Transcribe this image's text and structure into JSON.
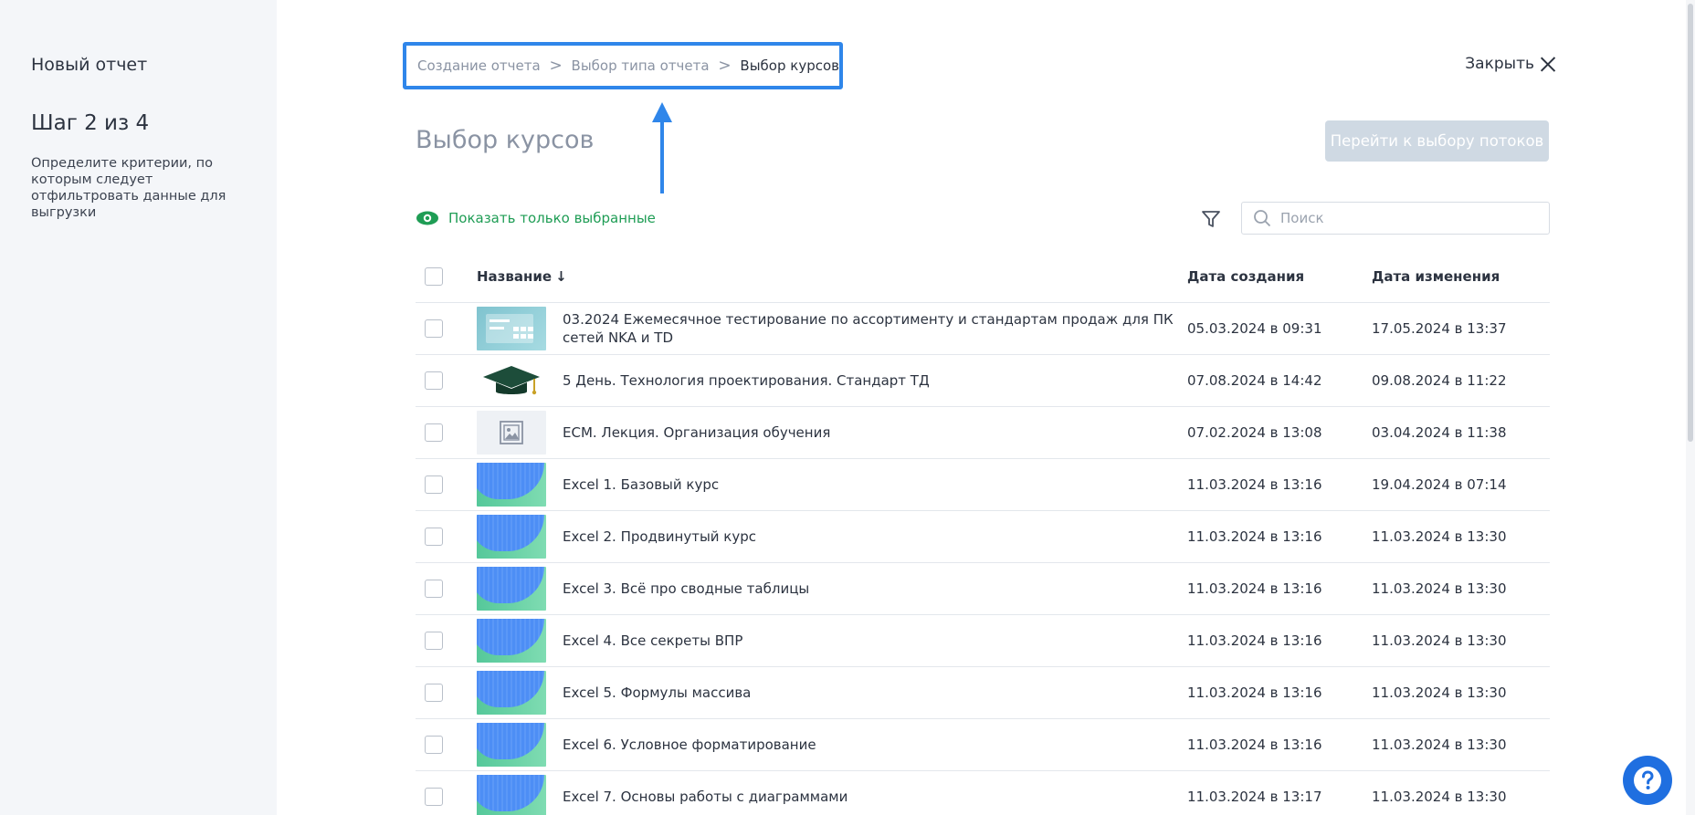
{
  "sidebar": {
    "title": "Новый отчет",
    "step": "Шаг 2 из 4",
    "description": "Определите критерии, по которым следует отфильтровать данные для выгрузки"
  },
  "breadcrumb": {
    "items": [
      "Создание отчета",
      "Выбор типа отчета",
      "Выбор курсов"
    ],
    "separator": ">"
  },
  "header": {
    "close_label": "Закрыть",
    "page_title": "Выбор курсов",
    "next_button": "Перейти к выбору потоков"
  },
  "toolbar": {
    "show_selected": "Показать только выбранные",
    "search_placeholder": "Поиск"
  },
  "table": {
    "columns": {
      "name": "Название",
      "created": "Дата создания",
      "modified": "Дата изменения"
    },
    "rows": [
      {
        "name": "03.2024 Ежемесячное тестирование по ассортименту и стандартам продаж для ПК сетей NKA и TD",
        "created": "05.03.2024 в 09:31",
        "modified": "17.05.2024 в 13:37",
        "thumb": "cyan"
      },
      {
        "name": "5 День. Технология проектирования. Стандарт ТД",
        "created": "07.08.2024 в 14:42",
        "modified": "09.08.2024 в 11:22",
        "thumb": "cap"
      },
      {
        "name": "ECM. Лекция. Организация обучения",
        "created": "07.02.2024 в 13:08",
        "modified": "03.04.2024 в 11:38",
        "thumb": "placeholder"
      },
      {
        "name": "Excel 1. Базовый курс",
        "created": "11.03.2024 в 13:16",
        "modified": "19.04.2024 в 07:14",
        "thumb": "excel"
      },
      {
        "name": "Excel 2. Продвинутый курс",
        "created": "11.03.2024 в 13:16",
        "modified": "11.03.2024 в 13:30",
        "thumb": "excel"
      },
      {
        "name": "Excel 3. Всё про сводные таблицы",
        "created": "11.03.2024 в 13:16",
        "modified": "11.03.2024 в 13:30",
        "thumb": "excel"
      },
      {
        "name": "Excel 4. Все секреты ВПР",
        "created": "11.03.2024 в 13:16",
        "modified": "11.03.2024 в 13:30",
        "thumb": "excel"
      },
      {
        "name": "Excel 5. Формулы массива",
        "created": "11.03.2024 в 13:16",
        "modified": "11.03.2024 в 13:30",
        "thumb": "excel"
      },
      {
        "name": "Excel 6. Условное форматирование",
        "created": "11.03.2024 в 13:16",
        "modified": "11.03.2024 в 13:30",
        "thumb": "excel"
      },
      {
        "name": "Excel 7. Основы работы с диаграммами",
        "created": "11.03.2024 в 13:17",
        "modified": "11.03.2024 в 13:30",
        "thumb": "excel"
      }
    ]
  },
  "colors": {
    "accent": "#2f86ea",
    "green": "#1f9d55",
    "disabled_button": "#cfd9e3",
    "help_button": "#1f6fe0"
  },
  "icons": [
    "eye-icon",
    "filter-icon",
    "search-icon",
    "close-icon",
    "help-icon",
    "image-placeholder-icon",
    "graduation-cap-icon"
  ]
}
